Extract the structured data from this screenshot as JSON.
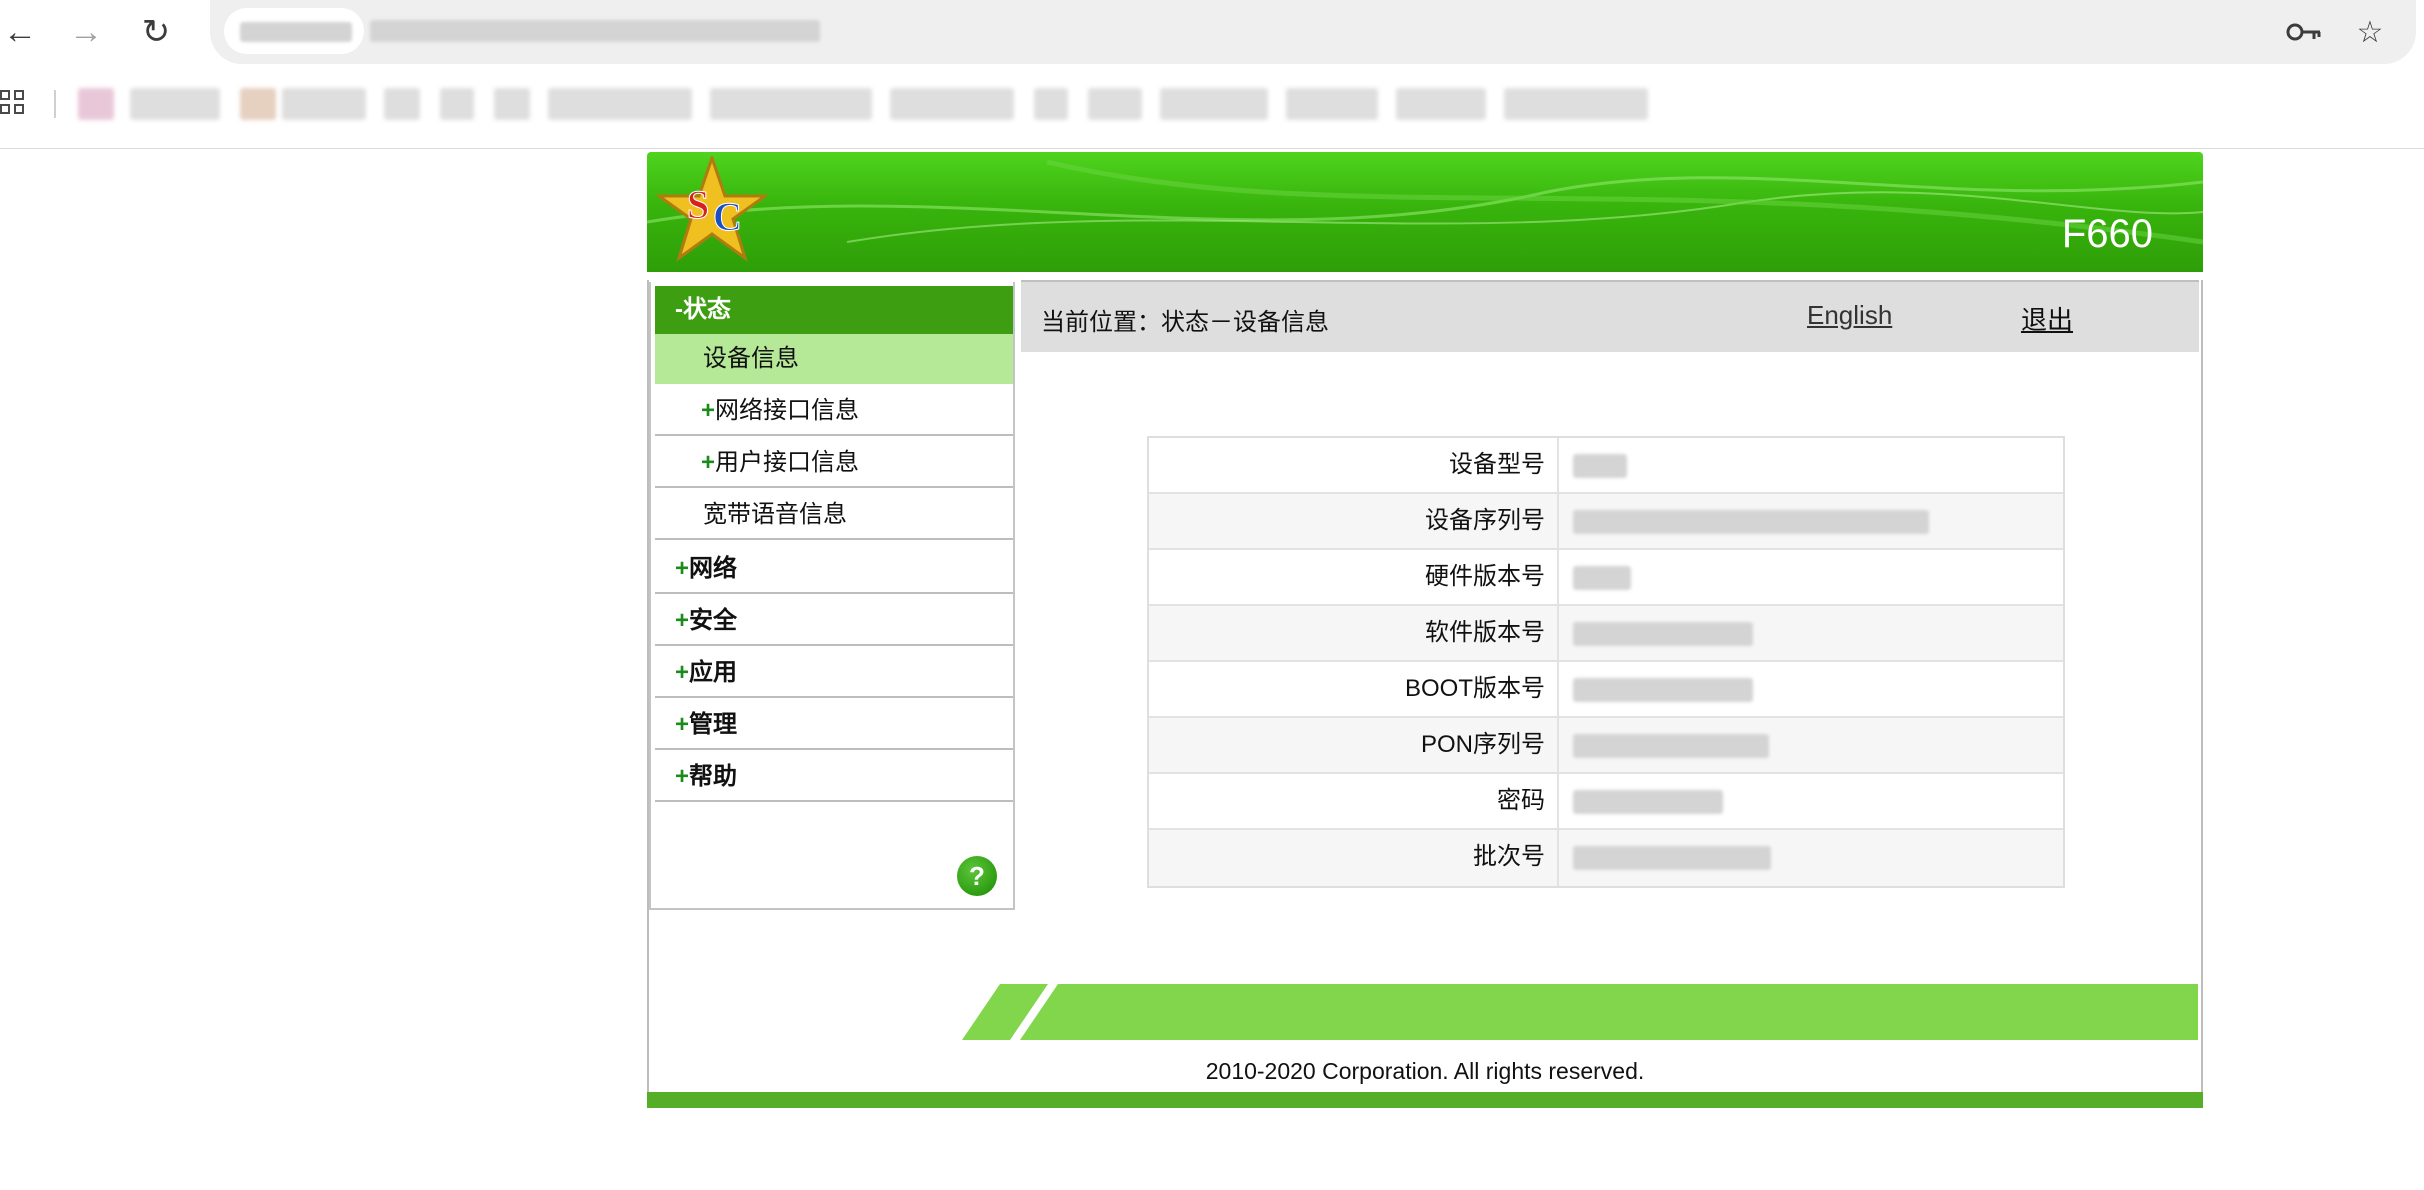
{
  "header": {
    "model": "F660",
    "logo_letters": "SC"
  },
  "sidebar": {
    "section_title": "-状态",
    "items": [
      {
        "label": "设备信息",
        "active": true
      },
      {
        "prefix": "+",
        "label": "网络接口信息"
      },
      {
        "prefix": "+",
        "label": "用户接口信息"
      },
      {
        "label": "宽带语音信息"
      }
    ],
    "menus": [
      {
        "prefix": "+",
        "label": "网络"
      },
      {
        "prefix": "+",
        "label": "安全"
      },
      {
        "prefix": "+",
        "label": "应用"
      },
      {
        "prefix": "+",
        "label": "管理"
      },
      {
        "prefix": "+",
        "label": "帮助"
      }
    ],
    "help_icon": "?"
  },
  "breadcrumb": {
    "text": "当前位置：状态－设备信息",
    "language_link": "English",
    "logout_link": "退出"
  },
  "device_info": {
    "rows": [
      {
        "label": "设备型号"
      },
      {
        "label": "设备序列号"
      },
      {
        "label": "硬件版本号"
      },
      {
        "label": "软件版本号"
      },
      {
        "label": "BOOT版本号"
      },
      {
        "label": "PON序列号"
      },
      {
        "label": "密码"
      },
      {
        "label": "批次号"
      }
    ]
  },
  "footer": {
    "copyright": "2010-2020 Corporation. All rights reserved."
  },
  "colors": {
    "banner_green": "#38b40c",
    "sidebar_header": "#3c9e10",
    "active_item": "#b5e897",
    "footer_band": "#82d64c",
    "bottom_bar": "#56ad28"
  }
}
